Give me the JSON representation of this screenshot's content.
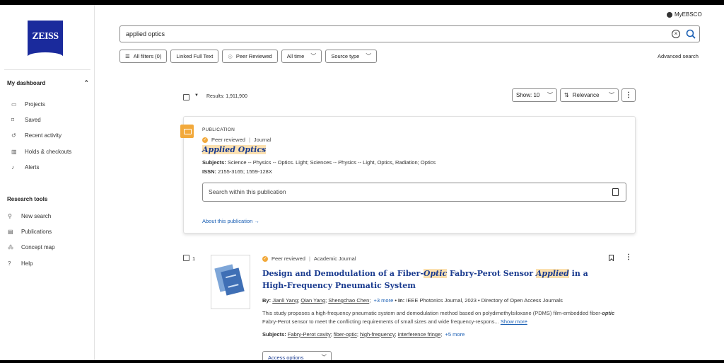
{
  "account": {
    "label": "MyEBSCO"
  },
  "brand": {
    "logo_text": "ZEISS",
    "logo_color": "#1a2a9c"
  },
  "sidebar": {
    "dashboard_title": "My dashboard",
    "dashboard_items": [
      {
        "label": "Projects",
        "icon": "folder-icon"
      },
      {
        "label": "Saved",
        "icon": "bookmark-icon"
      },
      {
        "label": "Recent activity",
        "icon": "history-icon"
      },
      {
        "label": "Holds & checkouts",
        "icon": "books-icon"
      },
      {
        "label": "Alerts",
        "icon": "bell-icon"
      }
    ],
    "research_title": "Research tools",
    "research_items": [
      {
        "label": "New search",
        "icon": "search-icon"
      },
      {
        "label": "Publications",
        "icon": "document-icon"
      },
      {
        "label": "Concept map",
        "icon": "network-icon"
      },
      {
        "label": "Help",
        "icon": "help-icon"
      }
    ]
  },
  "search": {
    "value": "applied optics"
  },
  "filters": {
    "all_filters": "All filters (0)",
    "linked_full_text": "Linked Full Text",
    "peer_reviewed": "Peer Reviewed",
    "all_time": "All time",
    "source_type": "Source type",
    "advanced": "Advanced search"
  },
  "results": {
    "count": "Results: 1,911,900",
    "show": "Show: 10",
    "sort": "Relevance"
  },
  "publication": {
    "type": "PUBLICATION",
    "peer": "Peer reviewed",
    "kind": "Journal",
    "title": "Applied Optics",
    "subjects_label": "Subjects:",
    "subjects": "Science -- Physics -- Optics. Light; Sciences -- Physics -- Light, Optics, Radiation; Optics",
    "issn_label": "ISSN:",
    "issn": "2155-3165; 1559-128X",
    "search_placeholder": "Search within this publication",
    "about": "About this publication"
  },
  "result1": {
    "number": "1",
    "peer": "Peer reviewed",
    "kind": "Academic Journal",
    "title_a": "Design and Demodulation of a Fiber-",
    "title_hl1": "Optic",
    "title_b": " Fabry-Perot Sensor ",
    "title_hl2": "Applied",
    "title_c": " in a High-Frequency Pneumatic System",
    "by_label": "By:",
    "authors": [
      "Jianli Yang",
      "Qian Yang",
      "Shengchao Chen"
    ],
    "more_authors": "+3 more",
    "in_label": "In:",
    "source": "IEEE Photonics Journal, 2023",
    "database": "Directory of Open Access Journals",
    "abstract_a": "This study proposes a high-frequency pneumatic system and demodulation method based on polydimethylsiloxane (PDMS) film-embedded fiber-",
    "abstract_hl": "optic",
    "abstract_b": " Fabry-Perot sensor to meet the conflicting requirements of small sizes and wide frequency-respons...",
    "show_more": "Show more",
    "subjects_label": "Subjects:",
    "subjects": [
      "Fabry-Perot cavity",
      "fiber-optic",
      "high-frequency",
      "interference fringe"
    ],
    "more_subjects": "+5 more",
    "access": "Access options"
  }
}
